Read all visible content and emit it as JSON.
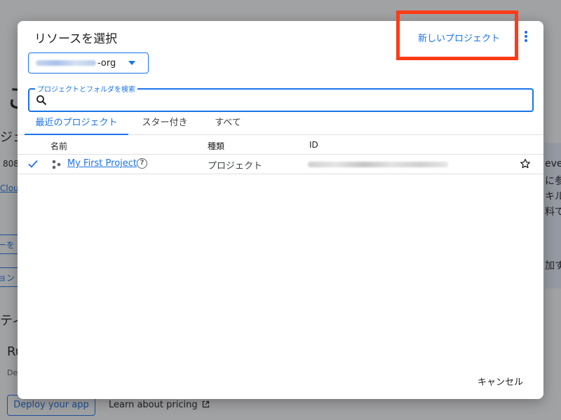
{
  "background": {
    "big_char": "こ",
    "line1": "ジェク",
    "line2": "808",
    "cloud_link": "Cloud",
    "chip1": "ーを",
    "chip2": "ョン",
    "line3": "ティ",
    "line4": "Ru",
    "line5": "De",
    "deploy_button": "Deploy your app",
    "pricing_link": "Learn about pricing",
    "panel_lines": [
      "eve",
      "に参",
      "キル",
      "料で",
      "加す"
    ]
  },
  "dialog": {
    "title": "リソースを選択",
    "new_project": "新しいプロジェクト",
    "org_suffix": "-org",
    "search": {
      "label": "プロジェクトとフォルダを検索",
      "value": ""
    },
    "tabs": [
      {
        "label": "最近のプロジェクト",
        "active": true
      },
      {
        "label": "スター付き",
        "active": false
      },
      {
        "label": "すべて",
        "active": false
      }
    ],
    "columns": {
      "name": "名前",
      "type": "種類",
      "id": "ID"
    },
    "rows": [
      {
        "name": "My First Project",
        "type": "プロジェクト",
        "help": "?"
      }
    ],
    "cancel": "キャンセル"
  },
  "colors": {
    "accent": "#1a73e8",
    "highlight": "#ff3b17"
  }
}
